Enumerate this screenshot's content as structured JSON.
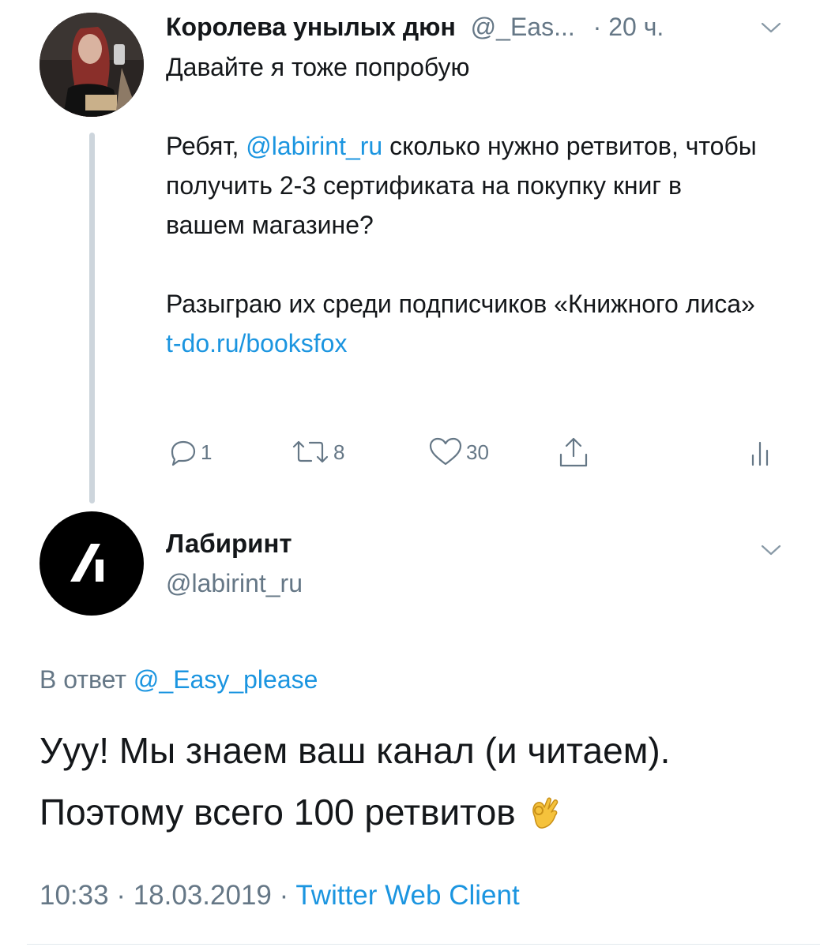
{
  "tweet1": {
    "author_name": "Королева унылых дюн",
    "author_handle": "@_Eas...",
    "dot": "·",
    "time": "20 ч.",
    "lines": {
      "p1": "Давайте я тоже попробую",
      "p2_before": "Ребят, ",
      "p2_mention": "@labirint_ru",
      "p2_after": " сколько нужно ретвитов, чтобы получить 2-3 сертификата на покупку книг в вашем магазине?",
      "p3_before": "Разыграю их среди подписчиков «Книжного лиса» ",
      "p3_link": "t-do.ru/booksfox"
    },
    "stats": {
      "replies": "1",
      "retweets": "8",
      "likes": "30"
    }
  },
  "tweet2": {
    "author_name": "Лабиринт",
    "author_handle": "@labirint_ru",
    "reply_prefix": "В ответ ",
    "reply_handle": "@_Easy_please",
    "body_line1": "Ууу! Мы знаем ваш канал (и читаем).",
    "body_line2": "Поэтому всего 100 ретвитов",
    "emoji": "ok-hand-emoji",
    "time": "10:33",
    "sep1": " · ",
    "date": "18.03.2019",
    "sep2": " · ",
    "client": "Twitter Web Client"
  },
  "colors": {
    "link": "#1b95e0",
    "muted": "#657786",
    "text": "#14171a"
  }
}
